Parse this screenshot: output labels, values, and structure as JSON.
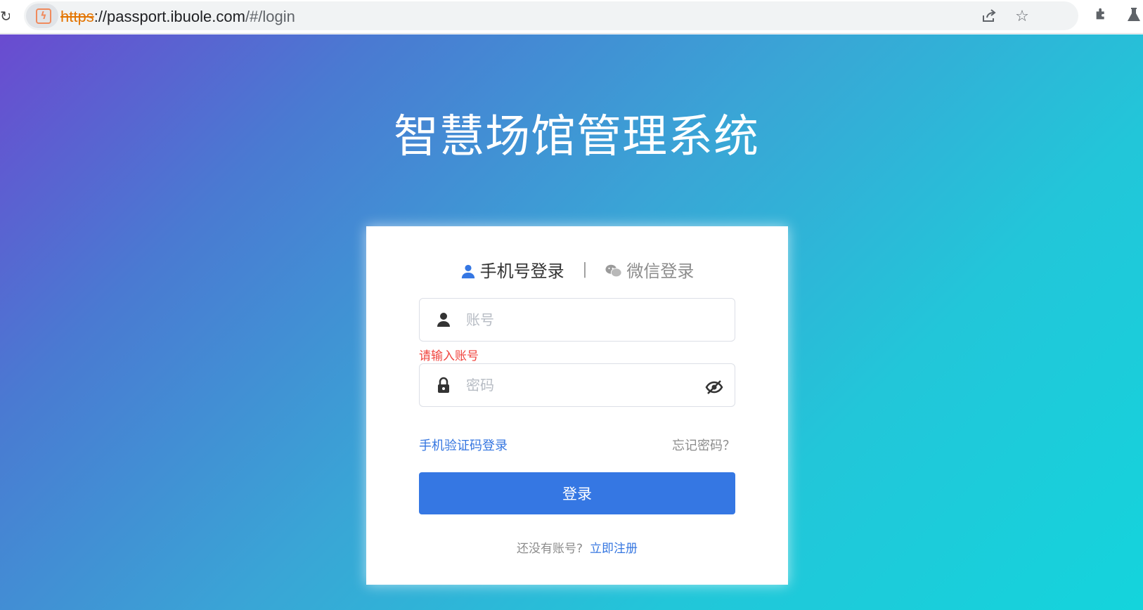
{
  "browser": {
    "url_scheme": "https",
    "url_host": "://passport.ibuole.com",
    "url_path": "/#/login",
    "icons": [
      "reload-icon",
      "site-info-icon",
      "share-icon",
      "bookmark-star-icon",
      "extensions-icon",
      "labs-icon"
    ]
  },
  "page": {
    "title": "智慧场馆管理系统"
  },
  "login": {
    "tabs": {
      "phone_label": "手机号登录",
      "separator": "|",
      "wechat_label": "微信登录"
    },
    "account": {
      "placeholder": "账号",
      "error": "请输入账号"
    },
    "password": {
      "placeholder": "密码"
    },
    "sms_login_link": "手机验证码登录",
    "forgot_password_link": "忘记密码？",
    "submit_label": "登录",
    "register_prompt": "还没有账号?",
    "register_link": "立即注册"
  },
  "colors": {
    "primary": "#3577e3",
    "error": "#f0443e",
    "gradient_start": "#6a4bd0",
    "gradient_end": "#14d4dc"
  }
}
